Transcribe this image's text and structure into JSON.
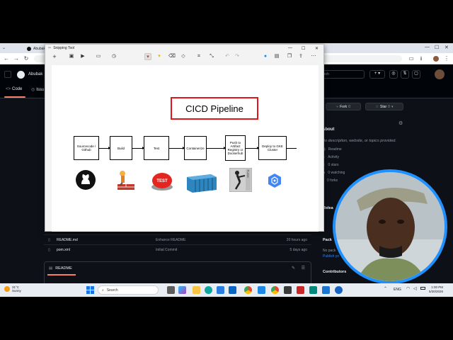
{
  "browser": {
    "tabs": [
      {
        "label": "Abubakr"
      },
      {
        "label": ""
      }
    ]
  },
  "github": {
    "repo_tabs": [
      {
        "label": "Code"
      },
      {
        "label": "Issu"
      }
    ],
    "owner_label": "Abubak",
    "search_placeholder": "rch",
    "fork_label": "Fork",
    "fork_count": "0",
    "star_label": "Star",
    "star_count": "0",
    "about": {
      "title": "About",
      "description": "No description, website, or topics provided.",
      "items": [
        {
          "label": "Readme"
        },
        {
          "label": "Activity"
        },
        {
          "label": "0 stars"
        },
        {
          "label": "0 watching"
        },
        {
          "label": "0 forks"
        }
      ]
    },
    "releases_label": "Relea",
    "packages_label": "Pack",
    "packages_desc": "No pack",
    "publish_link": "Publish yo",
    "contributors_label": "Contributors",
    "files": [
      {
        "name": "README.md",
        "commit": "Enhance README",
        "time": "20 hours ago"
      },
      {
        "name": "pom.xml",
        "commit": "Initial Commit",
        "time": "5 days ago"
      }
    ],
    "readme_label": "README"
  },
  "snipping_tool": {
    "title": "Snipping Tool",
    "diagram": {
      "title": "CICD Pipeline",
      "stages": [
        {
          "label": "Sourcecode / Github"
        },
        {
          "label": "Build"
        },
        {
          "label": "Test"
        },
        {
          "label": "Containerize"
        },
        {
          "label": "Push to Artifact Registry or Dockerhub"
        },
        {
          "label": "Deploy to GKE Cluster"
        }
      ],
      "test_icon_text": "TEST",
      "push_icon_text": "PUSH"
    }
  },
  "taskbar": {
    "weather_temp": "31°C",
    "weather_desc": "Sunny",
    "search_label": "Search",
    "language": "ENG",
    "time": "1:00 PM",
    "date": "5/30/2026"
  },
  "colors": {
    "github_bg": "#0d1117",
    "pipeline_title_border": "#e2151b",
    "webcam_ring": "#1e90ff",
    "chrome_accent": "#1a73e8"
  }
}
